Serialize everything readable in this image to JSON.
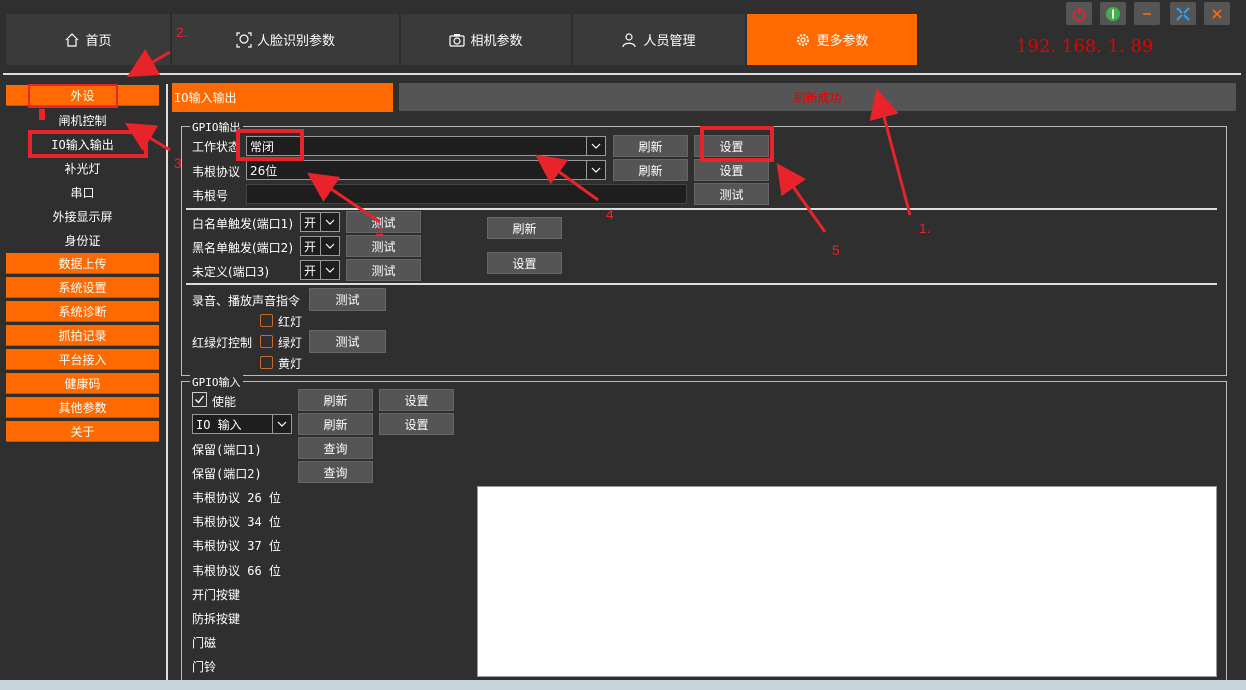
{
  "tabs": [
    {
      "label": "首页",
      "icon": "home-icon"
    },
    {
      "label": "人脸识别参数",
      "icon": "face-icon"
    },
    {
      "label": "相机参数",
      "icon": "camera-icon"
    },
    {
      "label": "人员管理",
      "icon": "user-icon"
    },
    {
      "label": "更多参数",
      "icon": "gear-icon"
    }
  ],
  "ip": "192. 168. 1. 89",
  "sidebar": {
    "items": [
      "外设",
      "闸机控制",
      "IO输入输出",
      "补光灯",
      "串口",
      "外接显示屏",
      "身份证",
      "数据上传",
      "系统设置",
      "系统诊断",
      "抓拍记录",
      "平台接入",
      "健康码",
      "其他参数",
      "关于"
    ]
  },
  "panel": {
    "tab_label": "IO输入输出",
    "status": "刷新成功"
  },
  "gpio_out": {
    "title": "GPIO输出",
    "work_state_label": "工作状态",
    "work_state_value": "常闭",
    "wiegand_label": "韦根协议",
    "wiegand_value": "26位",
    "wiegand_no_label": "韦根号",
    "refresh": "刷新",
    "set": "设置",
    "test": "测试",
    "whitelist_label": "白名单触发(端口1)",
    "blacklist_label": "黑名单触发(端口2)",
    "undefined_label": "未定义(端口3)",
    "toggle_value": "开",
    "record_label": "录音、播放声音指令",
    "traffic_label": "红绿灯控制",
    "red": "红灯",
    "green": "绿灯",
    "yellow": "黄灯"
  },
  "gpio_in": {
    "title": "GPIO输入",
    "enable": "使能",
    "io_mode": "IO 输入",
    "refresh": "刷新",
    "set": "设置",
    "query": "查询",
    "reserve1": "保留(端口1)",
    "reserve2": "保留(端口2)",
    "signals": [
      "韦根协议 26 位",
      "韦根协议 34 位",
      "韦根协议 37 位",
      "韦根协议 66 位",
      "开门按键",
      "防拆按键",
      "门磁",
      "门铃"
    ]
  },
  "annotations": [
    "1.",
    "2.",
    "3",
    "4",
    "4",
    "5"
  ],
  "colors": {
    "accent": "#ff6a00",
    "annotation": "#e8232a",
    "background": "#2f2f2f"
  }
}
